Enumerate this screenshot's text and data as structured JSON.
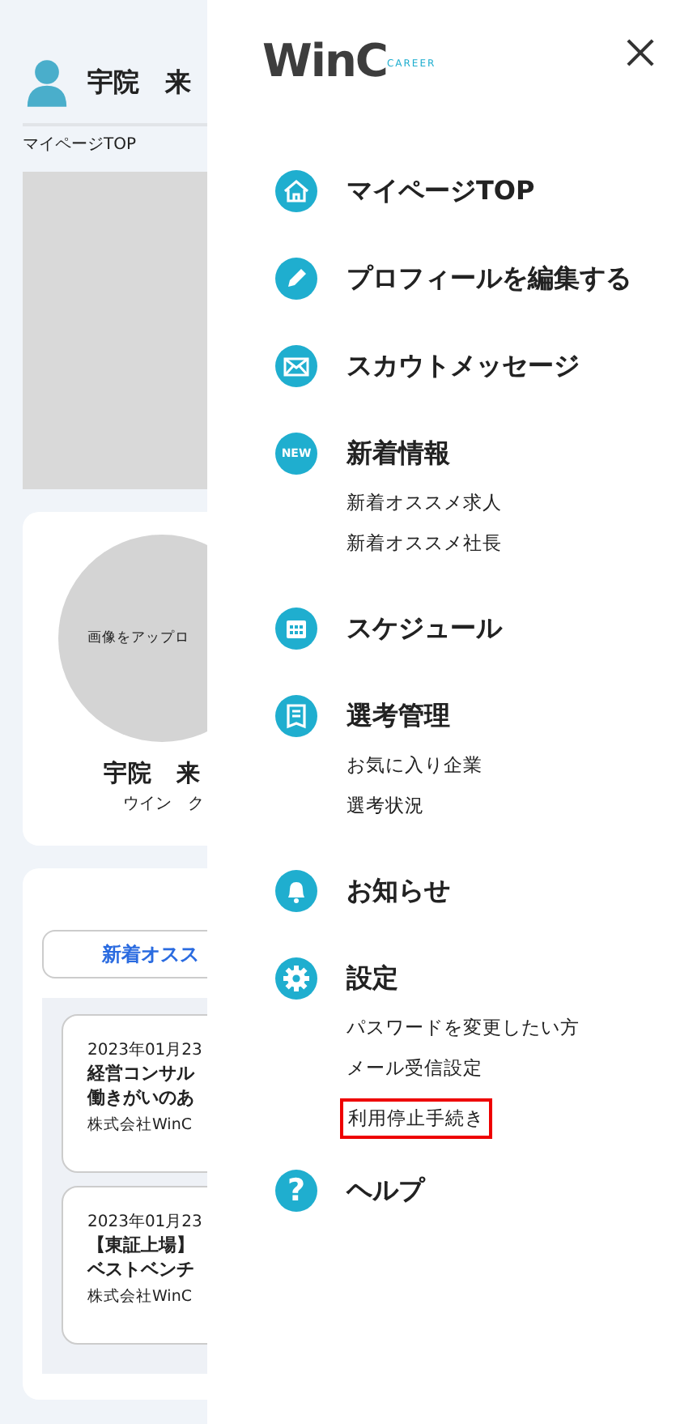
{
  "page": {
    "user_name": "宇院　来",
    "breadcrumb": "マイページTOP",
    "profile": {
      "upload_hint": "画像をアップロ",
      "name": "宇院　来",
      "kana": "ウイン　ク"
    },
    "recommend": {
      "tab": "新着オスス",
      "jobs": [
        {
          "date": "2023年01月23",
          "title": [
            "経営コンサル",
            "働きがいのあ"
          ],
          "company": "株式会社WinC"
        },
        {
          "date": "2023年01月23",
          "title": [
            "【東証上場】",
            "ベストベンチ"
          ],
          "company": "株式会社WinC"
        }
      ]
    }
  },
  "drawer": {
    "logo": {
      "text": "WinC",
      "tagline": "CAREER"
    },
    "menu": [
      {
        "kind": "home",
        "label": "マイページTOP"
      },
      {
        "kind": "pencil",
        "label": "プロフィールを編集する"
      },
      {
        "kind": "mail",
        "label": "スカウトメッセージ"
      },
      {
        "kind": "badge",
        "badge": "NEW",
        "label": "新着情報",
        "children": [
          {
            "label": "新着オススメ求人",
            "highlighted": false
          },
          {
            "label": "新着オススメ社長",
            "highlighted": false
          }
        ]
      },
      {
        "kind": "calendar",
        "label": "スケジュール"
      },
      {
        "kind": "clipboard",
        "label": "選考管理",
        "children": [
          {
            "label": "お気に入り企業",
            "highlighted": false
          },
          {
            "label": "選考状況",
            "highlighted": false
          }
        ]
      },
      {
        "kind": "bell",
        "label": "お知らせ"
      },
      {
        "kind": "gear",
        "label": "設定",
        "children": [
          {
            "label": "パスワードを変更したい方",
            "highlighted": false
          },
          {
            "label": "メール受信設定",
            "highlighted": false
          },
          {
            "label": "利用停止手続き",
            "highlighted": true
          }
        ]
      },
      {
        "kind": "badge",
        "badge": "?",
        "label": "ヘルプ"
      }
    ]
  }
}
